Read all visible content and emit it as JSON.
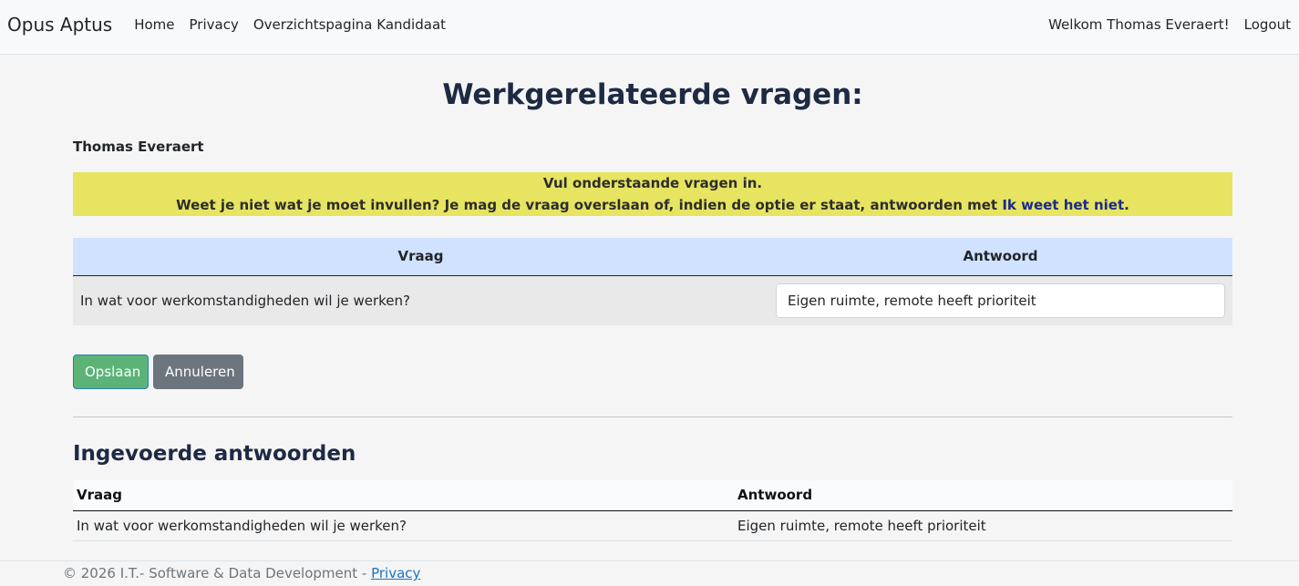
{
  "nav": {
    "brand": "Opus Aptus",
    "links": [
      "Home",
      "Privacy",
      "Overzichtspagina Kandidaat"
    ],
    "welcome": "Welkom Thomas Everaert!",
    "logout": "Logout"
  },
  "page": {
    "title": "Werkgerelateerde vragen:",
    "user_name": "Thomas Everaert"
  },
  "alert": {
    "line1": "Vul onderstaande vragen in.",
    "line2_prefix": "Weet je niet wat je moet invullen? Je mag de vraag overslaan of, indien de optie er staat, antwoorden met ",
    "line2_link": "Ik weet het niet",
    "line2_suffix": "."
  },
  "questions_table": {
    "headers": {
      "question": "Vraag",
      "answer": "Antwoord"
    },
    "rows": [
      {
        "question": "In wat voor werkomstandigheden wil je werken?",
        "answer": "Eigen ruimte, remote heeft prioriteit"
      }
    ]
  },
  "buttons": {
    "save": "Opslaan",
    "cancel": "Annuleren"
  },
  "answers_section": {
    "title": "Ingevoerde antwoorden",
    "headers": {
      "question": "Vraag",
      "answer": "Antwoord"
    },
    "rows": [
      {
        "question": "In wat voor werkomstandigheden wil je werken?",
        "answer": "Eigen ruimte, remote heeft prioriteit"
      }
    ]
  },
  "footer": {
    "text": "© 2026 I.T.- Software & Data Development - ",
    "link": "Privacy"
  },
  "colors": {
    "alert_bg": "#e6e461",
    "table_header_bg": "#d0e2ff",
    "save_button": "#5cb377",
    "cancel_button": "#6c757d"
  }
}
